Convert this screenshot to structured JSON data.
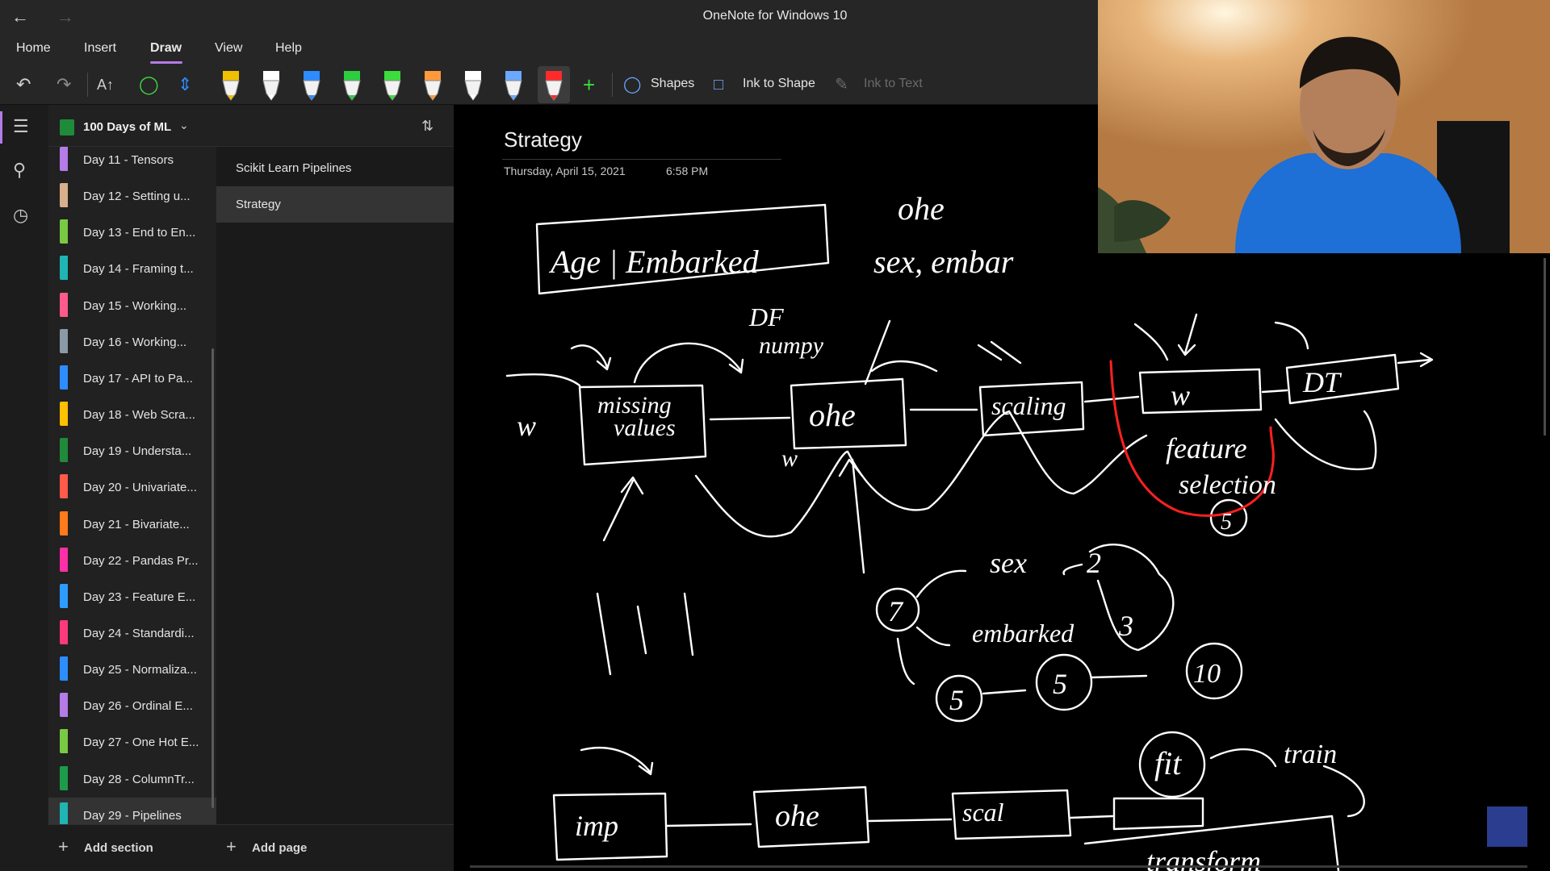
{
  "window": {
    "title": "OneNote for Windows 10"
  },
  "menu": [
    "Home",
    "Insert",
    "Draw",
    "View",
    "Help"
  ],
  "toolbar": {
    "shapes_label": "Shapes",
    "ink_to_shape_label": "Ink to Shape",
    "ink_to_text_label": "Ink to Text",
    "pen_colors": [
      "#f0c000",
      "#ffffff",
      "#2d8cff",
      "#2ecc40",
      "#3ddc3d",
      "#ff9a3c",
      "#ffffff",
      "#6aa9ff",
      "#ff2a2a"
    ]
  },
  "notebook": {
    "name": "100 Days of ML"
  },
  "sections": [
    {
      "label": "Day 11 - Tensors",
      "color": "#b57be6"
    },
    {
      "label": "Day 12 - Setting u...",
      "color": "#d8b08c"
    },
    {
      "label": "Day 13 - End to En...",
      "color": "#7ac943"
    },
    {
      "label": "Day 14 - Framing t...",
      "color": "#1fb5b5"
    },
    {
      "label": "Day 15 - Working...",
      "color": "#ff5a8a"
    },
    {
      "label": "Day 16 - Working...",
      "color": "#8a9aa6"
    },
    {
      "label": "Day 17 - API to Pa...",
      "color": "#2d8cff"
    },
    {
      "label": "Day 18 - Web Scra...",
      "color": "#ffc000"
    },
    {
      "label": "Day 19 - Understa...",
      "color": "#1f8a3a"
    },
    {
      "label": "Day 20 - Univariate...",
      "color": "#ff5a4a"
    },
    {
      "label": "Day 21 - Bivariate...",
      "color": "#ff7a1a"
    },
    {
      "label": "Day 22 - Pandas Pr...",
      "color": "#ff2fa8"
    },
    {
      "label": "Day 23 - Feature E...",
      "color": "#2d9cff"
    },
    {
      "label": "Day 24 - Standardi...",
      "color": "#ff3a7a"
    },
    {
      "label": "Day 25 - Normaliza...",
      "color": "#2d8cff"
    },
    {
      "label": "Day 26 - Ordinal E...",
      "color": "#b57be6"
    },
    {
      "label": "Day 27 - One Hot E...",
      "color": "#7ac943"
    },
    {
      "label": "Day 28 - ColumnTr...",
      "color": "#1f9a4a"
    },
    {
      "label": "Day 29 - Pipelines",
      "color": "#1fb5b5"
    }
  ],
  "pages": [
    {
      "label": "Scikit Learn Pipelines"
    },
    {
      "label": "Strategy"
    }
  ],
  "add_section_label": "Add section",
  "add_page_label": "Add page",
  "page": {
    "title": "Strategy",
    "date": "Thursday, April 15, 2021",
    "time": "6:58 PM"
  },
  "ink_text": {
    "box_top": "Age | Embarked",
    "ohe": "ohe",
    "sex_embar": "sex, embar",
    "df": "DF",
    "numpy": "numpy",
    "missing": "missing",
    "values": "values",
    "ohe_box": "ohe",
    "scaling": "scaling",
    "box_w": "w",
    "dt": "DT",
    "feature": "feature",
    "selection": "selection",
    "five_circle": "5",
    "sex": "sex",
    "two": "2",
    "seven": "7",
    "embarked": "embarked",
    "three": "3",
    "five_a": "5",
    "five_b": "5",
    "ten": "10",
    "fit": "fit",
    "train": "train",
    "imp": "imp",
    "ohe_bottom": "ohe",
    "scal": "scal",
    "transform": "transform",
    "w_left": "w",
    "w_mid": "w"
  }
}
